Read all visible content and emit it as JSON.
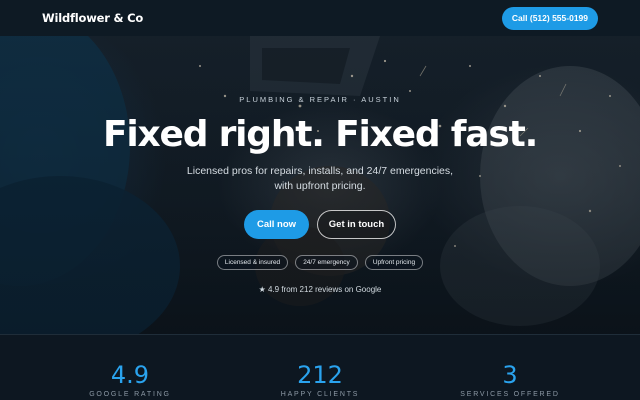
{
  "nav": {
    "brand": "Wildflower & Co",
    "call_label": "Call (512) 555-0199"
  },
  "hero": {
    "eyebrow": "PLUMBING & REPAIR · AUSTIN",
    "headline": "Fixed right. Fixed fast.",
    "subheadline": "Licensed pros for repairs, installs, and 24/7 emergencies, with upfront pricing.",
    "primary_cta": "Call now",
    "secondary_cta": "Get in touch",
    "badges": [
      "Licensed & insured",
      "24/7 emergency",
      "Upfront pricing"
    ],
    "rating_icon": "star-icon",
    "rating_text": "★ 4.9 from 212 reviews on Google"
  },
  "stats": [
    {
      "value": "4.9",
      "label": "GOOGLE RATING"
    },
    {
      "value": "212",
      "label": "HAPPY CLIENTS"
    },
    {
      "value": "3",
      "label": "SERVICES OFFERED"
    }
  ],
  "colors": {
    "accent": "#1e9be6",
    "stat_value": "#2aa3ee",
    "background": "#0b1620"
  }
}
